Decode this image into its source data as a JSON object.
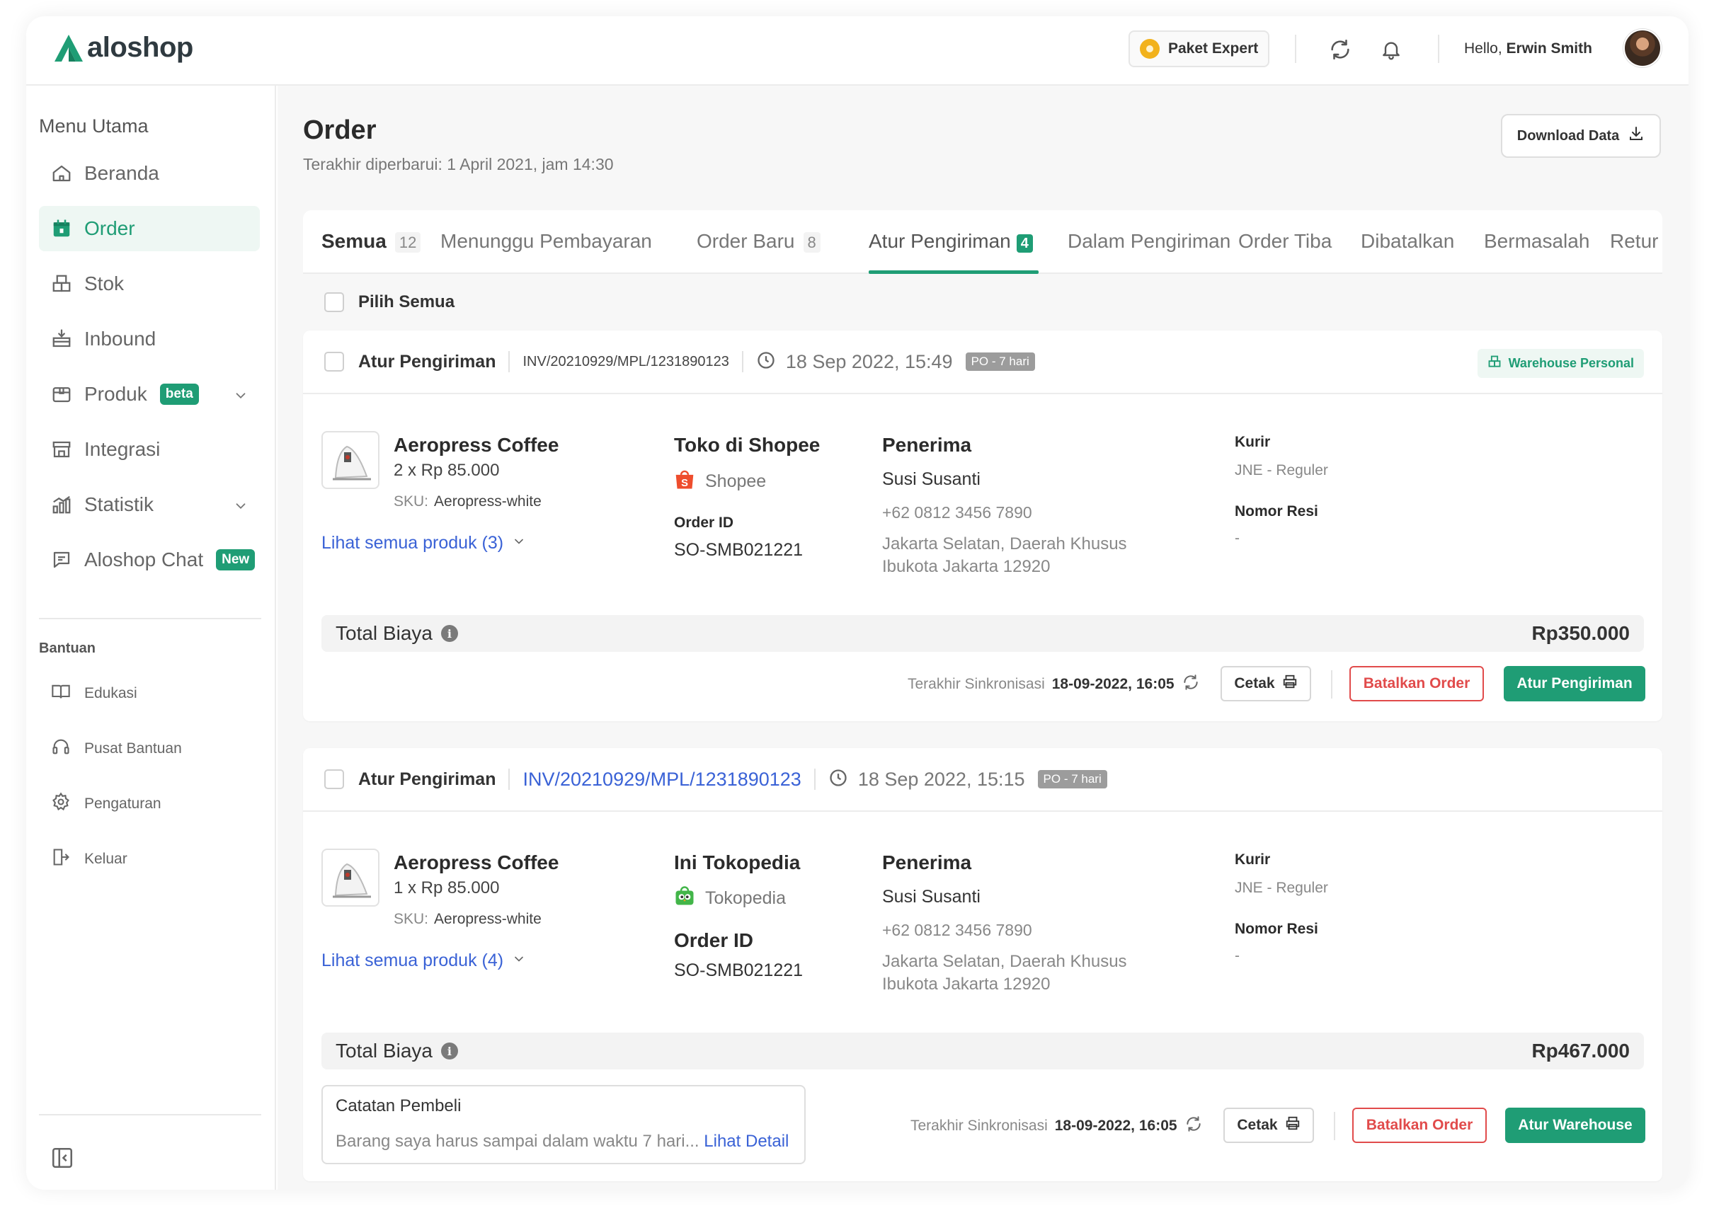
{
  "app": {
    "name": "aloshop"
  },
  "header": {
    "plan_label": "Paket Expert",
    "greeting": "Hello,",
    "user_name": "Erwin Smith"
  },
  "sidebar": {
    "menu_title": "Menu Utama",
    "items": [
      {
        "label": "Beranda",
        "icon": "home-icon"
      },
      {
        "label": "Order",
        "icon": "calendar-icon",
        "active": true
      },
      {
        "label": "Stok",
        "icon": "boxes-icon"
      },
      {
        "label": "Inbound",
        "icon": "inbound-icon"
      },
      {
        "label": "Produk",
        "icon": "box-icon",
        "badge": "beta"
      },
      {
        "label": "Integrasi",
        "icon": "store-icon"
      },
      {
        "label": "Statistik",
        "icon": "chart-icon"
      },
      {
        "label": "Aloshop Chat",
        "icon": "chat-icon",
        "badge": "New"
      }
    ],
    "help_title": "Bantuan",
    "help_items": [
      {
        "label": "Edukasi",
        "icon": "book-icon"
      },
      {
        "label": "Pusat Bantuan",
        "icon": "headset-icon"
      },
      {
        "label": "Pengaturan",
        "icon": "gear-icon"
      },
      {
        "label": "Keluar",
        "icon": "logout-icon"
      }
    ]
  },
  "main": {
    "title": "Order",
    "updated": "Terakhir diperbarui: 1 April 2021, jam 14:30",
    "download_label": "Download Data",
    "tabs": [
      {
        "label": "Semua",
        "count": "12"
      },
      {
        "label": "Menunggu Pembayaran"
      },
      {
        "label": "Order Baru",
        "count": "8"
      },
      {
        "label": "Atur Pengiriman",
        "count": "4",
        "active": true
      },
      {
        "label": "Dalam Pengiriman"
      },
      {
        "label": "Order Tiba"
      },
      {
        "label": "Dibatalkan"
      },
      {
        "label": "Bermasalah"
      },
      {
        "label": "Retur"
      }
    ],
    "select_all": "Pilih Semua"
  },
  "orders": [
    {
      "status": "Atur Pengiriman",
      "invoice": "INV/20210929/MPL/1231890123",
      "date": "18 Sep 2022, 15:49",
      "po_tag": "PO - 7 hari",
      "warehouse_tag": "Warehouse Personal",
      "product_name": "Aeropress Coffee",
      "product_qty": "2 x Rp 85.000",
      "sku_label": "SKU:",
      "sku_value": "Aeropress-white",
      "see_all": "Lihat semua produk (3)",
      "store_name": "Toko di Shopee",
      "marketplace": "Shopee",
      "order_id_label": "Order ID",
      "order_id": "SO-SMB021221",
      "recipient_label": "Penerima",
      "recipient_name": "Susi Susanti",
      "recipient_phone": "+62 0812 3456 7890",
      "recipient_address": "Jakarta Selatan, Daerah Khusus Ibukota Jakarta 12920",
      "courier_label": "Kurir",
      "courier": "JNE - Reguler",
      "resi_label": "Nomor Resi",
      "resi": "-",
      "total_label": "Total Biaya",
      "total": "Rp350.000",
      "sync_label": "Terakhir Sinkronisasi",
      "sync_time": "18-09-2022, 16:05",
      "print_label": "Cetak",
      "cancel_label": "Batalkan Order",
      "primary_label": "Atur Pengiriman"
    },
    {
      "status": "Atur Pengiriman",
      "invoice": "INV/20210929/MPL/1231890123",
      "date": "18 Sep 2022, 15:15",
      "po_tag": "PO - 7 hari",
      "product_name": "Aeropress Coffee",
      "product_qty": "1 x Rp 85.000",
      "sku_label": "SKU:",
      "sku_value": "Aeropress-white",
      "see_all": "Lihat semua produk (4)",
      "store_name": "Ini Tokopedia",
      "marketplace": "Tokopedia",
      "order_id_label": "Order ID",
      "order_id": "SO-SMB021221",
      "recipient_label": "Penerima",
      "recipient_name": "Susi Susanti",
      "recipient_phone": "+62 0812 3456 7890",
      "recipient_address": "Jakarta Selatan, Daerah Khusus Ibukota Jakarta 12920",
      "courier_label": "Kurir",
      "courier": "JNE - Reguler",
      "resi_label": "Nomor Resi",
      "resi": "-",
      "total_label": "Total Biaya",
      "total": "Rp467.000",
      "note_title": "Catatan Pembeli",
      "note_text": "Barang saya harus sampai dalam waktu 7 hari...",
      "note_link": "Lihat Detail",
      "sync_label": "Terakhir Sinkronisasi",
      "sync_time": "18-09-2022, 16:05",
      "print_label": "Cetak",
      "cancel_label": "Batalkan Order",
      "primary_label": "Atur Warehouse"
    }
  ],
  "colors": {
    "brand": "#1f9d75",
    "link": "#3a62d6",
    "danger": "#e14b4b",
    "shopee": "#ee4d2d",
    "tokopedia": "#42b549"
  }
}
